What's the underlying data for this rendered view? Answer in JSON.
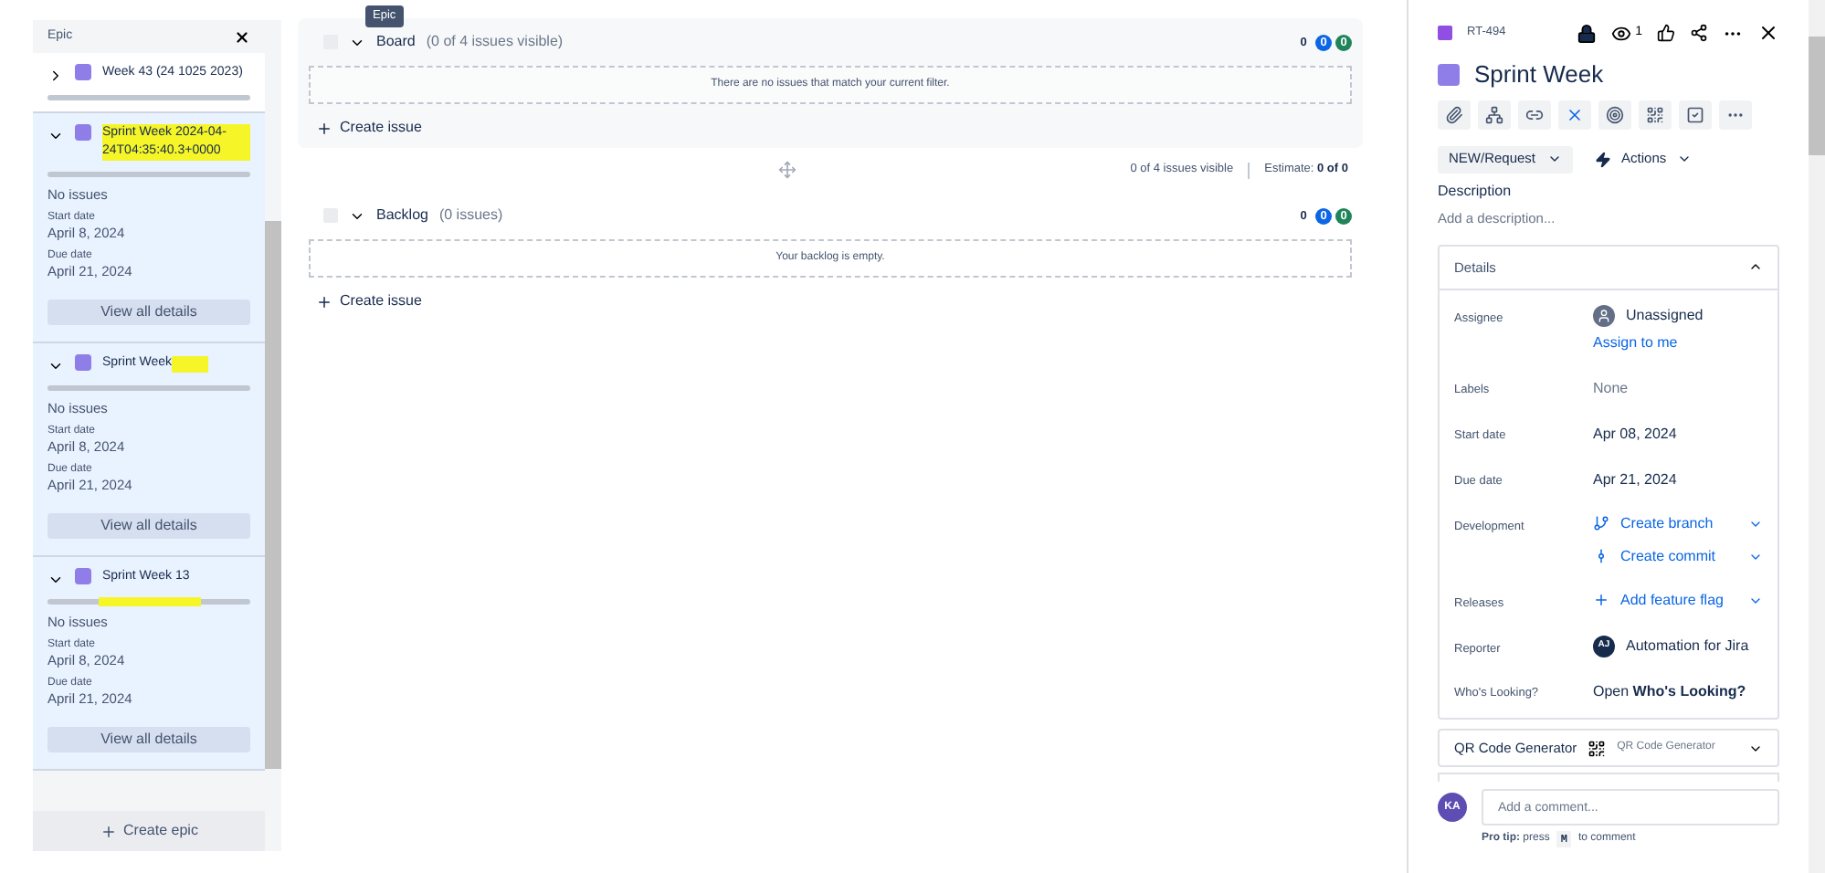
{
  "tooltip": "Epic",
  "epic_panel": {
    "title": "Epic",
    "epics": [
      {
        "name": "Week 43 (24 1025 2023)",
        "expanded": false,
        "kind": "plain",
        "level": 0
      },
      {
        "name": "Sprint Week 2024-04-24T04:35:40.3+0000",
        "expanded": true,
        "kind": "marked-title",
        "level": 0,
        "issues": "No issues",
        "start_label": "Start date",
        "start": "April 8, 2024",
        "due_label": "Due date",
        "due": "April 21, 2024",
        "details_button": "View all details"
      },
      {
        "name": "Sprint Week",
        "expanded": true,
        "kind": "marked-after-title",
        "level": 0,
        "issues": "No issues",
        "start_label": "Start date",
        "start": "April 8, 2024",
        "due_label": "Due date",
        "due": "April 21, 2024",
        "details_button": "View all details"
      },
      {
        "name": "Sprint Week 13",
        "expanded": true,
        "kind": "marked-bar",
        "level": 0,
        "issues": "No issues",
        "start_label": "Start date",
        "start": "April 8, 2024",
        "due_label": "Due date",
        "due": "April 21, 2024",
        "details_button": "View all details"
      }
    ],
    "create_button": "Create epic"
  },
  "board": {
    "checked": false,
    "title": "Board",
    "subtitle": "(0 of 4 issues visible)",
    "counts": [
      "0",
      "0",
      "0"
    ],
    "empty": "There are no issues that match your current filter.",
    "create": "Create issue",
    "visible": "0 of 4 issues visible",
    "estimate_label": "Estimate:",
    "estimate": "0 of 0"
  },
  "backlog": {
    "checked": false,
    "title": "Backlog",
    "subtitle": "(0 issues)",
    "counts": [
      "0",
      "0",
      "0"
    ],
    "empty": "Your backlog is empty.",
    "create": "Create issue"
  },
  "issue": {
    "key": "RT-494",
    "watchers": "1",
    "title": "Sprint Week",
    "status": "NEW/Request",
    "actions": "Actions",
    "description_label": "Description",
    "description_placeholder": "Add a description...",
    "details": {
      "title": "Details",
      "expanded": true,
      "rows": [
        {
          "kind": "user",
          "label": "Assignee",
          "value": "Unassigned",
          "link": "Assign to me"
        },
        {
          "kind": "text",
          "label": "Labels",
          "value": "None",
          "muted": true
        },
        {
          "kind": "text",
          "label": "Start date",
          "value": "Apr 08, 2024",
          "muted": false
        },
        {
          "kind": "text",
          "label": "Due date",
          "value": "Apr 21, 2024",
          "muted": false
        },
        {
          "kind": "links",
          "label": "Development",
          "links": [
            {
              "kind": "branch",
              "text": "Create branch"
            },
            {
              "kind": "commit",
              "text": "Create commit"
            }
          ]
        },
        {
          "kind": "links",
          "label": "Releases",
          "links": [
            {
              "kind": "add",
              "text": "Add feature flag"
            }
          ]
        },
        {
          "kind": "avatar",
          "label": "Reporter",
          "initials": "AJ",
          "value": "Automation for Jira"
        },
        {
          "kind": "rich",
          "label": "Who's Looking?",
          "value": "Open **Who's Looking?**"
        }
      ]
    },
    "qr": {
      "label": "QR Code Generator",
      "value": "QR Code Generator"
    },
    "comment": {
      "initials": "KA",
      "placeholder": "Add a comment...",
      "tip": "**Pro tip:** press",
      "key": "M",
      "tip_end": "to comment"
    }
  }
}
